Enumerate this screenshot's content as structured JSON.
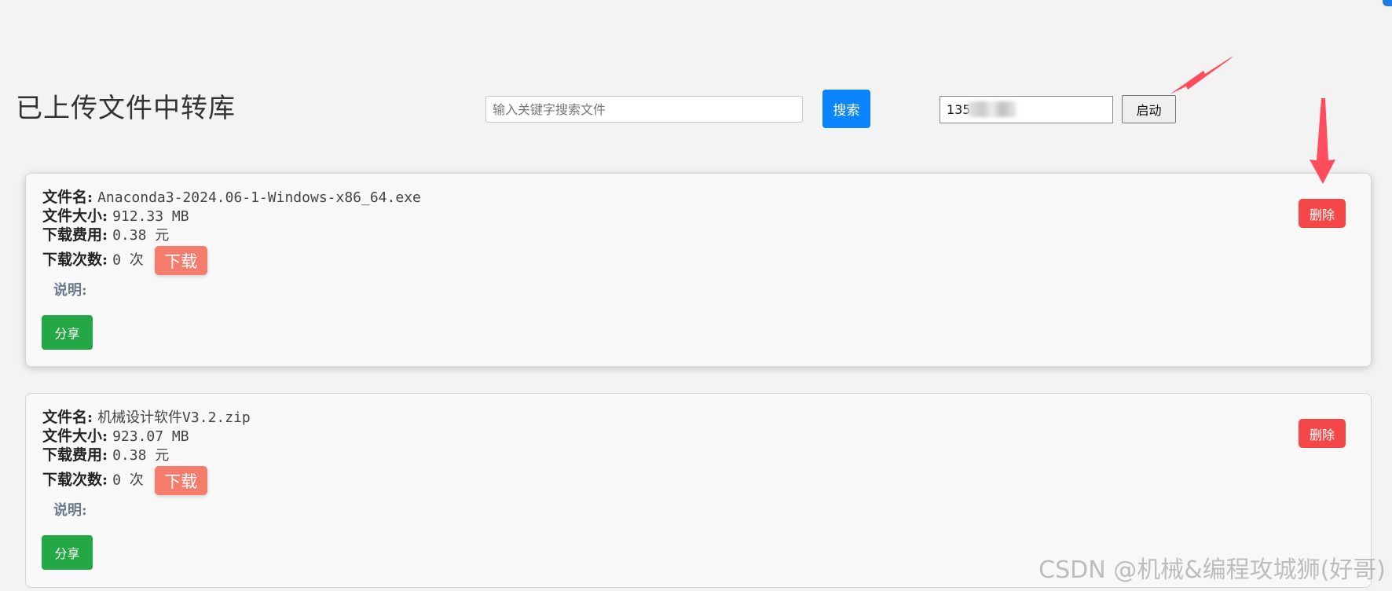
{
  "header": {
    "title": "已上传文件中转库",
    "search_placeholder": "输入关键字搜索文件",
    "search_button": "搜索",
    "phone_value": "135",
    "start_button": "启动"
  },
  "labels": {
    "filename": "文件名:",
    "filesize": "文件大小:",
    "fee": "下载费用:",
    "count": "下载次数:",
    "desc": "说明:",
    "download": "下载",
    "share": "分享",
    "delete": "删除"
  },
  "files": [
    {
      "name": "Anaconda3-2024.06-1-Windows-x86_64.exe",
      "size": "912.33 MB",
      "fee": "0.38 元",
      "count": "0 次",
      "desc": ""
    },
    {
      "name": "机械设计软件V3.2.zip",
      "size": "923.07 MB",
      "fee": "0.38 元",
      "count": "0 次",
      "desc": ""
    }
  ],
  "watermark": "CSDN @机械&编程攻城狮(好哥)",
  "colors": {
    "search_button": "#0a84ff",
    "download_button": "#f47c6c",
    "share_button": "#24a745",
    "delete_button": "#f44848",
    "annotation_arrow": "#ff4d5e"
  }
}
